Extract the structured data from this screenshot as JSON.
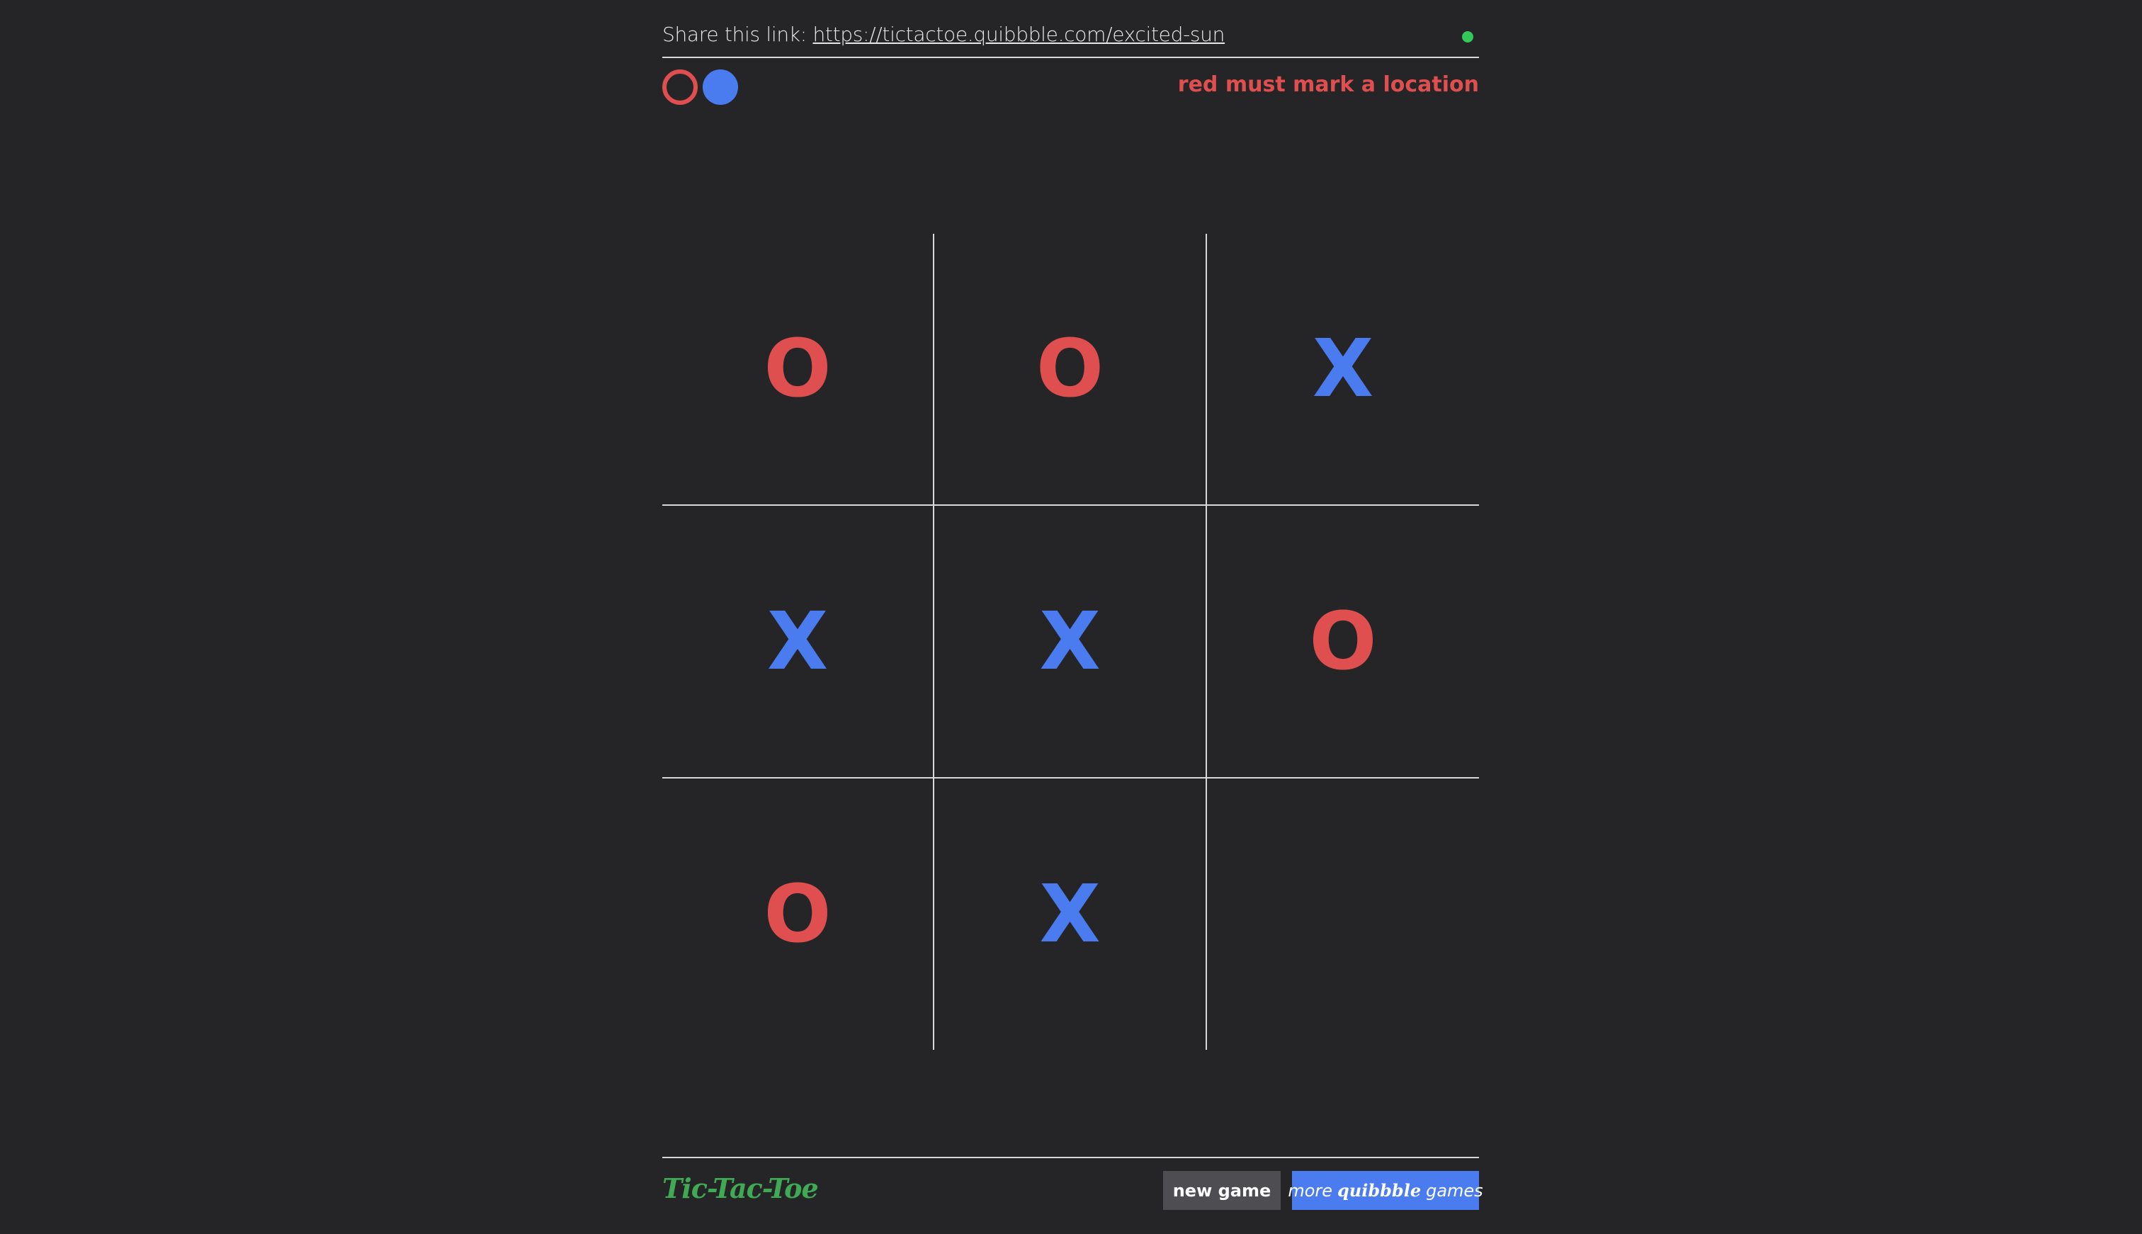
{
  "header": {
    "share_prefix": "Share this link:",
    "share_url": "https://tictactoe.quibbble.com/excited-sun",
    "connection_status_color": "#34c759"
  },
  "players": {
    "red": {
      "color": "#e04f4f",
      "indicator": "ring-icon"
    },
    "blue": {
      "color": "#4a7cf0",
      "indicator": "disc-icon"
    }
  },
  "status": {
    "text": "red must mark a location",
    "color": "#e04f4f"
  },
  "board": {
    "cells": [
      {
        "mark": "O",
        "player": "red"
      },
      {
        "mark": "O",
        "player": "red"
      },
      {
        "mark": "X",
        "player": "blue"
      },
      {
        "mark": "X",
        "player": "blue"
      },
      {
        "mark": "X",
        "player": "blue"
      },
      {
        "mark": "O",
        "player": "red"
      },
      {
        "mark": "O",
        "player": "red"
      },
      {
        "mark": "X",
        "player": "blue"
      },
      {
        "mark": "",
        "player": ""
      }
    ]
  },
  "footer": {
    "logo_text": "Tic-Tac-Toe",
    "new_game_label": "new game",
    "more_games_prefix": "more",
    "more_games_brand": "quibbble",
    "more_games_suffix": "games"
  }
}
